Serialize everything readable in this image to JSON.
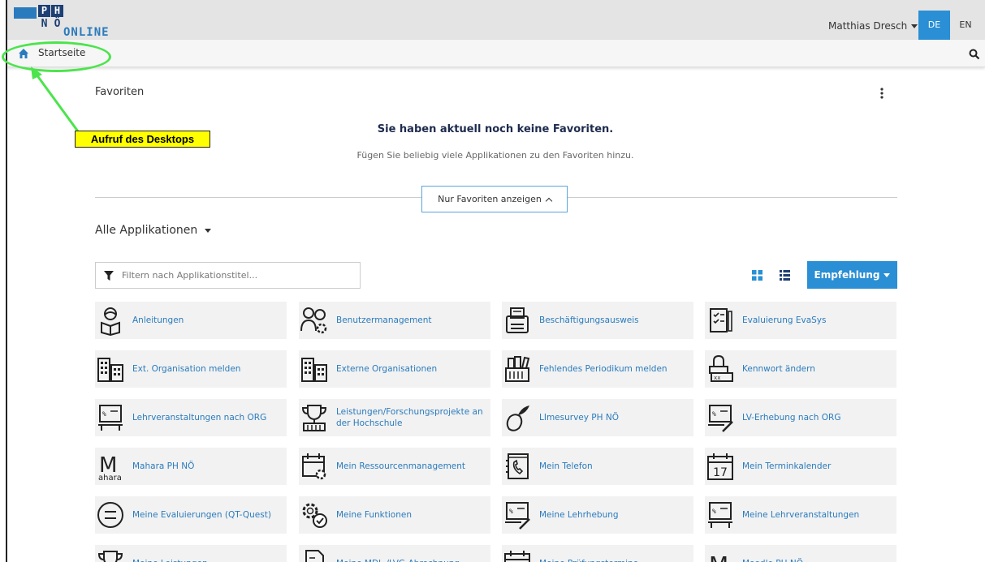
{
  "header": {
    "logo_p": "P",
    "logo_h": "H",
    "logo_n": "N",
    "logo_o": "Ö",
    "logo_online": "ONLINE",
    "user_name": "Matthias Dresch",
    "lang_de": "DE",
    "lang_en": "EN",
    "accent_color": "#2a8fd4"
  },
  "navbar": {
    "home_label": "Startseite",
    "home_icon": "home-icon",
    "search_icon": "search-icon"
  },
  "annotation": {
    "callout_text": "Aufruf des Desktops",
    "callout_color": "#ffff00",
    "highlight_color": "#4ce44c"
  },
  "favorites": {
    "title": "Favoriten",
    "empty_title": "Sie haben aktuell noch keine Favoriten.",
    "empty_subtitle": "Fügen Sie beliebig viele Applikationen zu den Favoriten hinzu.",
    "toggle_label": "Nur Favoriten anzeigen"
  },
  "applications": {
    "section_title": "Alle Applikationen",
    "filter_placeholder": "Filtern nach Applikationstitel...",
    "sort_button_label": "Empfehlung",
    "items": [
      {
        "label": "Anleitungen",
        "icon": "reader-icon"
      },
      {
        "label": "Benutzermanagement",
        "icon": "users-gear-icon"
      },
      {
        "label": "Beschäftigungsausweis",
        "icon": "id-card-printer-icon"
      },
      {
        "label": "Evaluierung EvaSys",
        "icon": "checklist-icon"
      },
      {
        "label": "Ext. Organisation melden",
        "icon": "buildings-icon"
      },
      {
        "label": "Externe Organisationen",
        "icon": "buildings-icon"
      },
      {
        "label": "Fehlendes Periodikum melden",
        "icon": "books-icon"
      },
      {
        "label": "Kennwort ändern",
        "icon": "password-lock-icon"
      },
      {
        "label": "Lehrveranstaltungen nach ORG",
        "icon": "lecture-board-icon"
      },
      {
        "label": "Leistungen/Forschungsprojekte an der Hochschule",
        "icon": "trophy-icon"
      },
      {
        "label": "LImesurvey PH NÖ",
        "icon": "fruit-icon"
      },
      {
        "label": "LV-Erhebung nach ORG",
        "icon": "lecture-board-pen-icon"
      },
      {
        "label": "Mahara PH NÖ",
        "icon": "mahara-logo-icon",
        "icon_text": "M",
        "icon_sub": "ahara"
      },
      {
        "label": "Mein Ressourcenmanagement",
        "icon": "calendar-gear-icon"
      },
      {
        "label": "Mein Telefon",
        "icon": "phone-book-icon"
      },
      {
        "label": "Mein Terminkalender",
        "icon": "calendar-icon",
        "icon_text": "17"
      },
      {
        "label": "Meine Evaluierungen (QT-Quest)",
        "icon": "neutral-face-icon"
      },
      {
        "label": "Meine Funktionen",
        "icon": "gears-check-icon"
      },
      {
        "label": "Meine Lehrhebung",
        "icon": "lecture-board-pen-icon"
      },
      {
        "label": "Meine Lehrveranstaltungen",
        "icon": "lecture-board-icon"
      },
      {
        "label": "Meine Leistungen",
        "icon": "trophy-icon"
      },
      {
        "label": "Meine MDL-/LVG-Abrechnung -",
        "icon": "document-icon"
      },
      {
        "label": "Meine Prüfungstermine",
        "icon": "calendar-icon"
      },
      {
        "label": "Moodle PH NÖ",
        "icon": "moodle-logo-icon",
        "icon_text": "M"
      }
    ]
  }
}
